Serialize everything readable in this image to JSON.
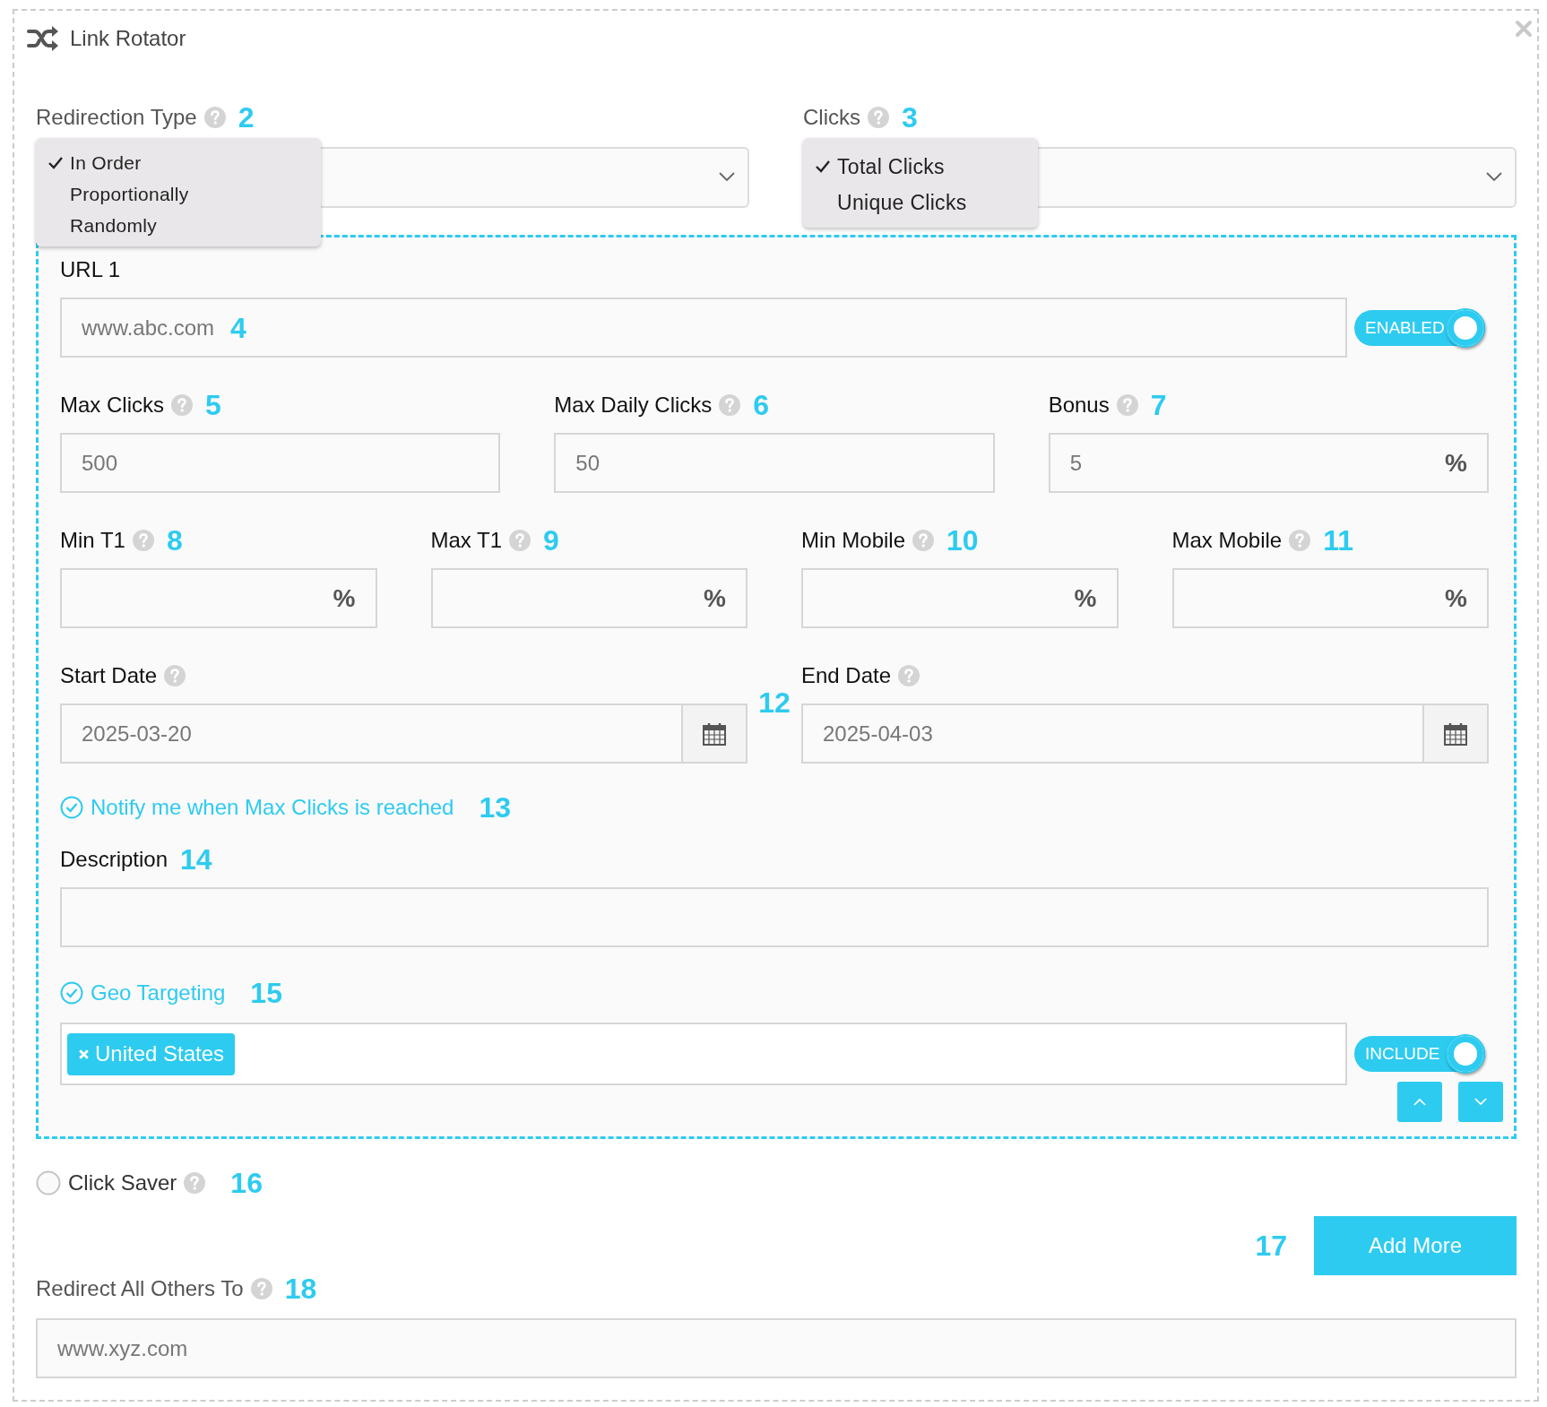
{
  "window": {
    "title": "Link Rotator"
  },
  "top_fields": [
    {
      "label": "Redirection Type",
      "help": true,
      "marker": "2",
      "menu": [
        {
          "label": "In Order",
          "selected": true
        },
        {
          "label": "Proportionally",
          "selected": false
        },
        {
          "label": "Randomly",
          "selected": false
        }
      ]
    },
    {
      "label": "Clicks",
      "help": true,
      "marker": "3",
      "menu": [
        {
          "label": "Total Clicks",
          "selected": true
        },
        {
          "label": "Unique Clicks",
          "selected": false
        }
      ]
    }
  ],
  "url": {
    "label": "URL 1",
    "value": "www.abc.com",
    "marker": "4",
    "toggle": {
      "label": "ENABLED",
      "on": true
    }
  },
  "limits": [
    {
      "label": "Max Clicks",
      "help": true,
      "marker": "5",
      "value": "500"
    },
    {
      "label": "Max Daily Clicks",
      "help": true,
      "marker": "6",
      "value": "50"
    },
    {
      "label": "Bonus",
      "help": true,
      "marker": "7",
      "value": "5",
      "suffix": "%"
    }
  ],
  "ranges": [
    {
      "label": "Min T1",
      "help": true,
      "marker": "8",
      "suffix": "%"
    },
    {
      "label": "Max T1",
      "help": true,
      "marker": "9",
      "suffix": "%"
    },
    {
      "label": "Min Mobile",
      "help": true,
      "marker": "10",
      "suffix": "%"
    },
    {
      "label": "Max Mobile",
      "help": true,
      "marker": "11",
      "suffix": "%"
    }
  ],
  "dates": {
    "marker": "12",
    "fields": [
      {
        "label": "Start Date",
        "help": true,
        "value": "2025-03-20"
      },
      {
        "label": "End Date",
        "help": true,
        "value": "2025-04-03"
      }
    ]
  },
  "notify": {
    "label": "Notify me when Max Clicks is reached",
    "checked": true,
    "marker": "13"
  },
  "description": {
    "label": "Description",
    "marker": "14"
  },
  "geo": {
    "label": "Geo Targeting",
    "checked": true,
    "marker": "15",
    "tags": [
      "United States"
    ],
    "toggle": {
      "label": "INCLUDE",
      "on": true
    }
  },
  "click_saver": {
    "label": "Click Saver",
    "help": true,
    "checked": false,
    "marker": "16"
  },
  "add_more": {
    "label": "Add More",
    "marker": "17"
  },
  "redirect_others": {
    "label": "Redirect All Others To",
    "help": true,
    "marker": "18",
    "value": "www.xyz.com"
  }
}
